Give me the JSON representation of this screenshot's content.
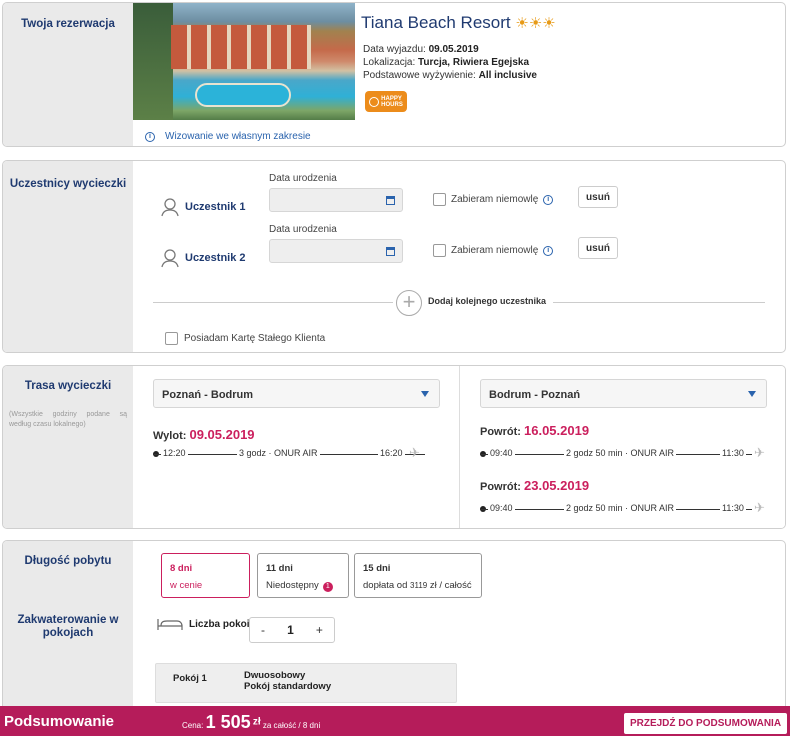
{
  "reservation": {
    "side_title": "Twoja rezerwacja",
    "hotel_name": "Tiana Beach Resort",
    "departure_label": "Data wyjazdu: ",
    "departure_value": "09.05.2019",
    "location_label": "Lokalizacja: ",
    "location_value": "Turcja, Riwiera Egejska",
    "board_label": "Podstawowe wyżywienie: ",
    "board_value": "All inclusive",
    "badge_line1": "HAPPY",
    "badge_line2": "HOURS",
    "visa_text": "Wizowanie we własnym zakresie",
    "star_icon": "sun-star-icon",
    "stars": 3
  },
  "participants": {
    "side_title": "Uczestnicy wycieczki",
    "dob_label": "Data urodzenia",
    "baby_label": "Zabieram niemowlę",
    "remove_label": "usuń",
    "items": [
      {
        "name": "Uczestnik 1"
      },
      {
        "name": "Uczestnik 2"
      }
    ],
    "add_label": "Dodaj kolejnego uczestnika",
    "card_label": "Posiadam Kartę Stałego Klienta"
  },
  "route": {
    "side_title": "Trasa wycieczki",
    "note": "(Wszystkie godziny podane są według czasu lokalnego)",
    "outbound": {
      "select": "Poznań - Bodrum",
      "label": "Wylot: ",
      "date": "09.05.2019",
      "depart": "12:20",
      "info": "3 godz · ONUR AIR",
      "arrive": "16:20"
    },
    "return": {
      "select": "Bodrum - Poznań",
      "label": "Powrót: ",
      "options": [
        {
          "date": "16.05.2019",
          "depart": "09:40",
          "info": "2 godz 50 min · ONUR AIR",
          "arrive": "11:30"
        },
        {
          "date": "23.05.2019",
          "depart": "09:40",
          "info": "2 godz 50 min · ONUR AIR",
          "arrive": "11:30"
        }
      ]
    }
  },
  "stay": {
    "side_title": "Długość pobytu",
    "options": [
      {
        "days": "8 dni",
        "note": "w cenie"
      },
      {
        "days": "11 dni",
        "note": "Niedostępny",
        "badge": "1"
      },
      {
        "days": "15 dni",
        "note_prefix": "dopłata od ",
        "note_amount": "3119",
        "note_suffix": " zł / całość"
      }
    ]
  },
  "accommodation": {
    "side_title": "Zakwaterowanie w pokojach",
    "rooms_label": "Liczba pokoi",
    "minus": "-",
    "rooms_value": "1",
    "plus": "+",
    "room_label": "Pokój 1",
    "room_type": "Dwuosobowy",
    "room_standard": "Pokój standardowy"
  },
  "summary_bar": {
    "title": "Podsumowanie",
    "price_label": "Cena: ",
    "price_value": "1 505",
    "currency": "zł",
    "price_suffix": " za całość / 8 dni",
    "button": "PRZEJDŹ DO PODSUMOWANIA"
  },
  "colors": {
    "navy": "#1f3a70",
    "accent": "#cb1f5d",
    "bar": "#b51c5a",
    "link": "#2a63ad"
  }
}
